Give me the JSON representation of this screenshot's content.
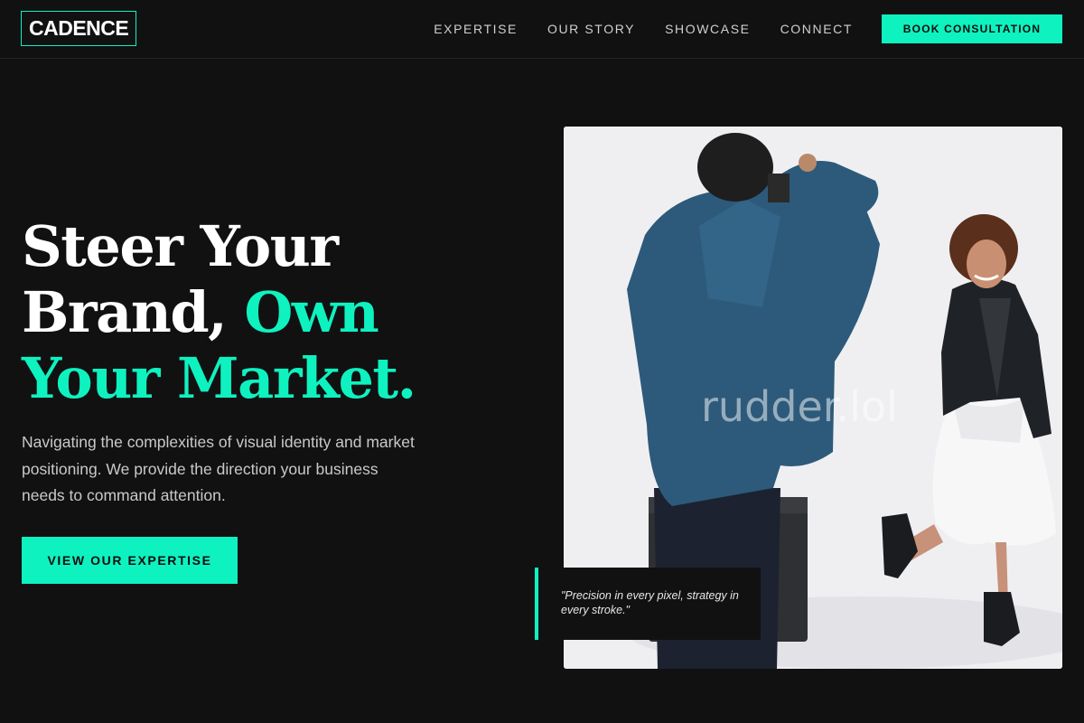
{
  "brand": {
    "logo": "CADENCE",
    "accent": "#0ef2c0",
    "background": "#111112"
  },
  "nav": {
    "items": [
      "EXPERTISE",
      "OUR STORY",
      "SHOWCASE",
      "CONNECT"
    ],
    "cta": "BOOK CONSULTATION"
  },
  "hero": {
    "title_line1": "Steer Your",
    "title_line2_plain": "Brand, ",
    "title_line2_accent": "Own",
    "title_line3_accent": "Your Market.",
    "subtitle": "Navigating the complexities of visual identity and market positioning. We provide the direction your business needs to command attention.",
    "cta": "VIEW OUR EXPERTISE"
  },
  "photo": {
    "watermark": "rudder.lol",
    "quote": "\"Precision in every pixel, strategy in every stroke.\""
  }
}
